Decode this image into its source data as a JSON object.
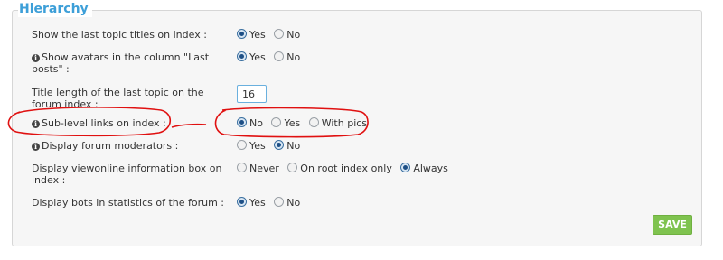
{
  "legend": "Hierarchy",
  "settings": [
    {
      "label": "Show the last topic titles on index :",
      "info": false,
      "options": [
        {
          "label": "Yes",
          "checked": true
        },
        {
          "label": "No",
          "checked": false
        }
      ]
    },
    {
      "label": "Show avatars in the column \"Last posts\" :",
      "info": true,
      "options": [
        {
          "label": "Yes",
          "checked": true
        },
        {
          "label": "No",
          "checked": false
        }
      ]
    },
    {
      "label": "Title length of the last topic on the forum index :",
      "info": false,
      "value": "16"
    },
    {
      "label": "Sub-level links on index :",
      "info": true,
      "options": [
        {
          "label": "No",
          "checked": true
        },
        {
          "label": "Yes",
          "checked": false
        },
        {
          "label": "With pics",
          "checked": false
        }
      ]
    },
    {
      "label": "Display forum moderators :",
      "info": true,
      "options": [
        {
          "label": "Yes",
          "checked": false
        },
        {
          "label": "No",
          "checked": true
        }
      ]
    },
    {
      "label": "Display viewonline information box on index :",
      "info": false,
      "options": [
        {
          "label": "Never",
          "checked": false
        },
        {
          "label": "On root index only",
          "checked": false
        },
        {
          "label": "Always",
          "checked": true
        }
      ]
    },
    {
      "label": "Display bots in statistics of the forum :",
      "info": false,
      "options": [
        {
          "label": "Yes",
          "checked": true
        },
        {
          "label": "No",
          "checked": false
        }
      ]
    }
  ],
  "save_label": "SAVE",
  "icons": {
    "info": "info-icon",
    "radio": "radio-button"
  },
  "colors": {
    "legend": "#3d9fd8",
    "save_button": "#7fc34f",
    "annotation": "#e01010",
    "radio_checked": "#1d4f86"
  }
}
